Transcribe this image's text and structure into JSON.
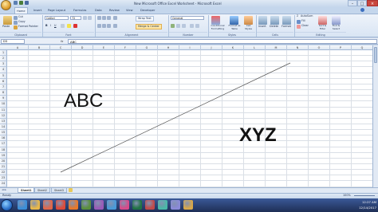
{
  "window": {
    "title": "New Microsoft Office Excel Worksheet - Microsoft Excel",
    "controls": [
      "–",
      "□",
      "×"
    ]
  },
  "ribbon": {
    "tabs": [
      "Home",
      "Insert",
      "Page Layout",
      "Formulas",
      "Data",
      "Review",
      "View",
      "Developer"
    ],
    "active_tab": "Home",
    "clipboard": {
      "paste": "Paste",
      "cut": "Cut",
      "copy": "Copy",
      "format_painter": "Format Painter",
      "label": "Clipboard"
    },
    "font": {
      "name": "Calibri",
      "size": "72",
      "label": "Font"
    },
    "alignment": {
      "wrap_text": "Wrap Text",
      "merge_center": "Merge & Center",
      "label": "Alignment"
    },
    "number": {
      "format": "General",
      "label": "Number"
    },
    "styles": {
      "conditional": "Conditional Formatting",
      "format_table": "Format as Table",
      "cell_styles": "Cell Styles",
      "label": "Styles"
    },
    "cells": {
      "insert": "Insert",
      "delete": "Delete",
      "format": "Format",
      "label": "Cells"
    },
    "editing": {
      "autosum": "AutoSum",
      "fill": "Fill",
      "clear": "Clear",
      "sort": "Sort & Filter",
      "find": "Find & Select",
      "label": "Editing"
    }
  },
  "formula_bar": {
    "name_box": "D3",
    "fx": "fx",
    "value": "ABC"
  },
  "grid": {
    "columns": [
      "A",
      "B",
      "C",
      "D",
      "E",
      "F",
      "G",
      "H",
      "I",
      "J",
      "K",
      "L",
      "M",
      "N",
      "O",
      "P",
      "Q"
    ],
    "rows": [
      "1",
      "2",
      "3",
      "4",
      "5",
      "6",
      "7",
      "8",
      "9",
      "10",
      "11",
      "12",
      "13",
      "14",
      "15",
      "16",
      "17",
      "18",
      "19",
      "20",
      "21",
      "22",
      "23",
      "24"
    ],
    "text_abc": "ABC",
    "text_xyz": "XYZ"
  },
  "sheets": [
    "Sheet1",
    "Sheet2",
    "Sheet3"
  ],
  "active_sheet": "Sheet1",
  "status": {
    "ready": "Ready",
    "zoom": "100%"
  },
  "taskbar": {
    "time": "12:27 AM",
    "date": "12/14/2017",
    "apps": [
      "ie-icon",
      "folder-icon",
      "media-icon",
      "chrome-icon",
      "firefox-icon",
      "app-icon",
      "app-icon",
      "app-icon",
      "app-icon",
      "excel-icon",
      "app-icon",
      "app-icon",
      "app-icon",
      "app-icon"
    ]
  },
  "colors": {
    "ribbon_bg": "#dfe9f5",
    "taskbar": "#1e2e55",
    "accent": "#2a6fc9"
  }
}
